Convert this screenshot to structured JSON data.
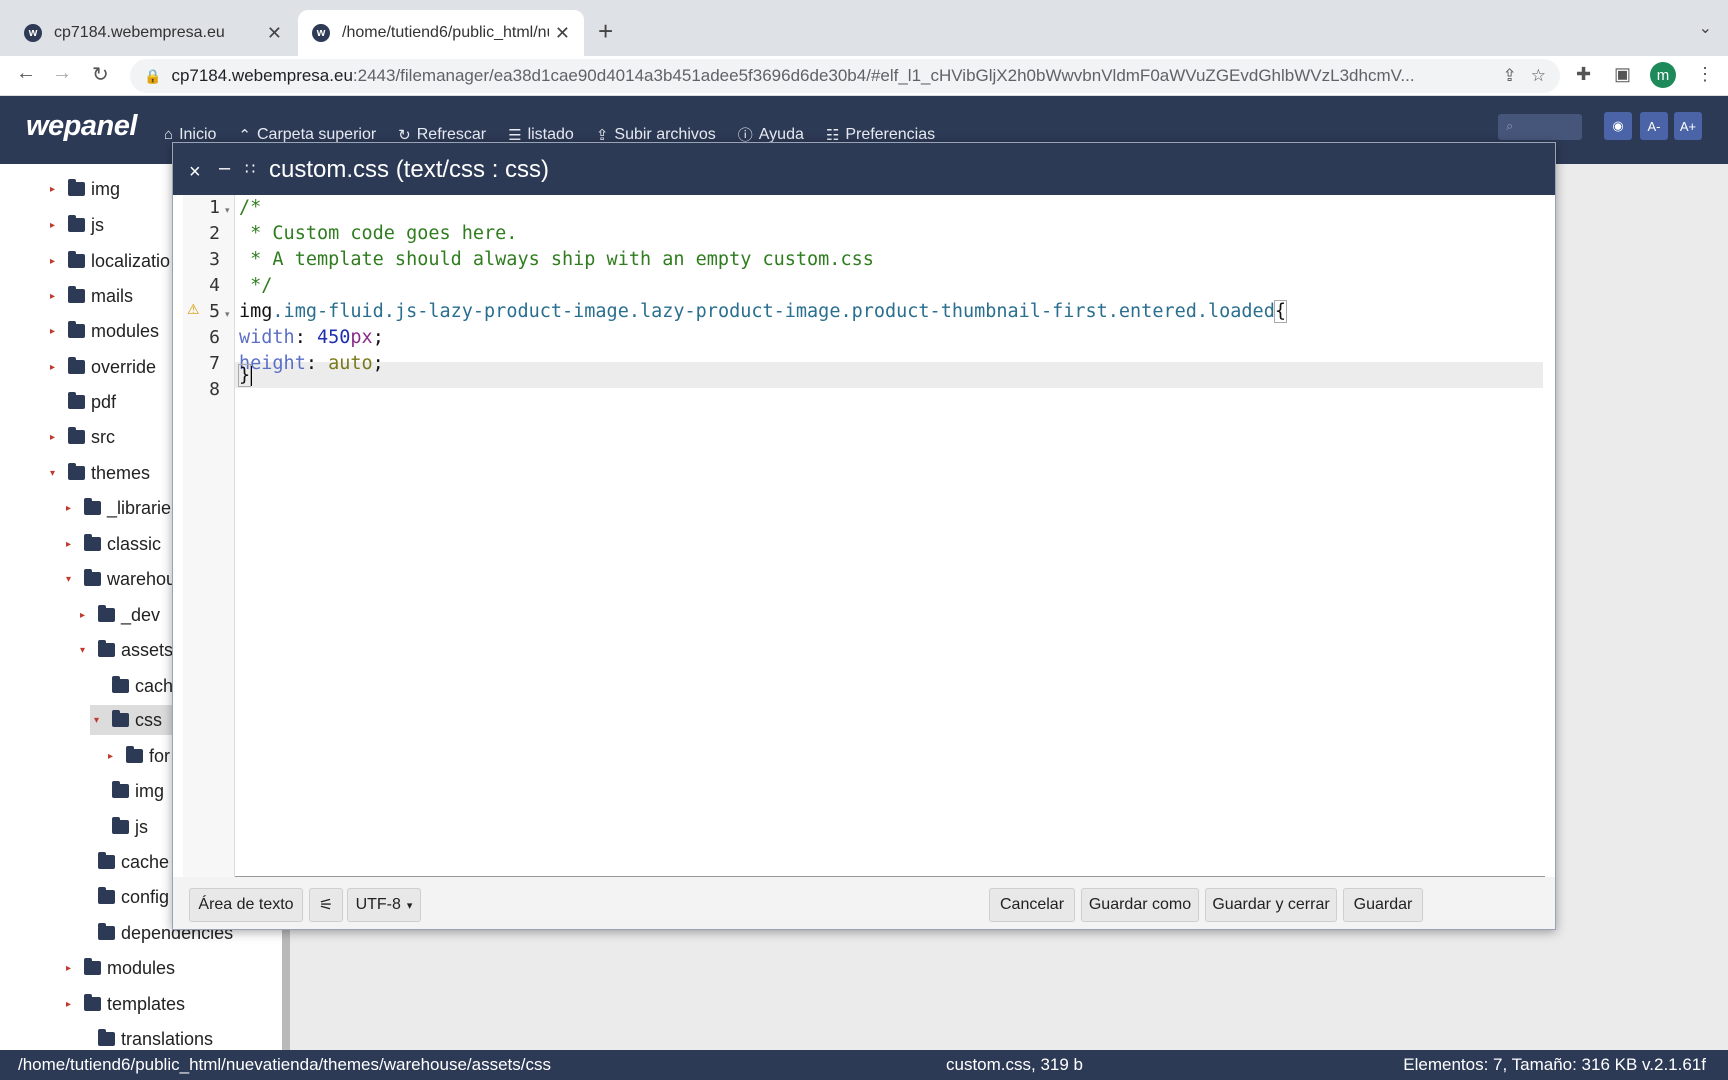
{
  "browser": {
    "tabs": [
      {
        "title": "cp7184.webempresa.eu",
        "icon": "wepanel-favicon"
      },
      {
        "title": "/home/tutiend6/public_html/nu",
        "icon": "wepanel-favicon"
      }
    ],
    "url_host": "cp7184.webempresa.eu",
    "url_rest": ":2443/filemanager/ea38d1cae90d4014a3b451adee5f3696d6de30b4/#elf_l1_cHVibGljX2h0bWwvbnVldmF0aWVuZGEvdGhlbWVzL3dhcmV...",
    "profile_initial": "m"
  },
  "app": {
    "logo": "wepanel",
    "menu": [
      {
        "label": "Inicio",
        "icon": "home-icon"
      },
      {
        "label": "Carpeta superior",
        "icon": "up-arrow-icon"
      },
      {
        "label": "Refrescar",
        "icon": "refresh-icon"
      },
      {
        "label": "listado",
        "icon": "list-icon"
      },
      {
        "label": "Subir archivos",
        "icon": "upload-icon"
      },
      {
        "label": "Ayuda",
        "icon": "help-icon"
      },
      {
        "label": "Preferencias",
        "icon": "sliders-icon"
      }
    ],
    "font_smaller": "A-",
    "font_bigger": "A+"
  },
  "tree": [
    {
      "label": "img",
      "arrow": "▸"
    },
    {
      "label": "js",
      "arrow": "▸"
    },
    {
      "label": "localizatio",
      "arrow": "▸"
    },
    {
      "label": "mails",
      "arrow": "▸"
    },
    {
      "label": "modules",
      "arrow": "▸"
    },
    {
      "label": "override",
      "arrow": "▸"
    },
    {
      "label": "pdf",
      "arrow": ""
    },
    {
      "label": "src",
      "arrow": "▸"
    },
    {
      "label": "themes",
      "arrow": "▾"
    },
    {
      "label": "_librarie",
      "arrow": "▸"
    },
    {
      "label": "classic",
      "arrow": "▸"
    },
    {
      "label": "warehou",
      "arrow": "▾"
    },
    {
      "label": "_dev",
      "arrow": "▸"
    },
    {
      "label": "assets",
      "arrow": "▾"
    },
    {
      "label": "cach",
      "arrow": ""
    },
    {
      "label": "css",
      "arrow": "▾"
    },
    {
      "label": "for",
      "arrow": "▸"
    },
    {
      "label": "img",
      "arrow": ""
    },
    {
      "label": "js",
      "arrow": ""
    },
    {
      "label": "cache",
      "arrow": ""
    },
    {
      "label": "config",
      "arrow": ""
    },
    {
      "label": "dependencies",
      "arrow": ""
    },
    {
      "label": "modules",
      "arrow": "▸"
    },
    {
      "label": "templates",
      "arrow": "▸"
    },
    {
      "label": "translations",
      "arrow": ""
    }
  ],
  "editor": {
    "title": "custom.css (text/css : css)",
    "line_numbers": [
      "1",
      "2",
      "3",
      "4",
      "5",
      "6",
      "7",
      "8"
    ],
    "lines": {
      "l1": "/*",
      "l2": " * Custom code goes here.",
      "l3": " * A template should always ship with an empty custom.css",
      "l4": " */",
      "l5_tag": "img",
      "l5_class": ".img-fluid.js-lazy-product-image.lazy-product-image.product-thumbnail-first.entered.loaded",
      "l5_brace": "{",
      "l6_prop": "width",
      "l6_colon": ": ",
      "l6_num": "450",
      "l6_unit": "px",
      "l6_end": ";",
      "l7_prop": "height",
      "l7_colon": ": ",
      "l7_val": "auto",
      "l7_end": ";",
      "l8": "}"
    },
    "footer": {
      "textarea_label": "Área de texto",
      "encoding": "UTF-8",
      "cancel": "Cancelar",
      "save_as": "Guardar como",
      "save_close": "Guardar y cerrar",
      "save": "Guardar"
    }
  },
  "status": {
    "path": "/home/tutiend6/public_html/nuevatienda/themes/warehouse/assets/css",
    "file": "custom.css, 319 b",
    "summary": "Elementos: 7, Tamaño: 316 KB v.2.1.61f"
  }
}
